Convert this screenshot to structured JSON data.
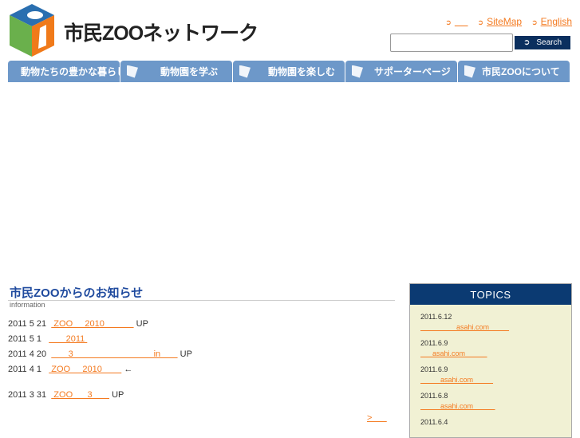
{
  "header": {
    "site_title": "市民ZOOネットワーク",
    "links": [
      "     ",
      "SiteMap",
      "English"
    ],
    "search_placeholder": "",
    "search_label": "Search"
  },
  "nav": [
    "動物たちの豊かな暮らし",
    "動物園を学ぶ",
    "動物園を楽しむ",
    "サポーターページ",
    "市民ZOOについて"
  ],
  "info": {
    "title": "市民ZOOからのお知らせ",
    "subtitle": "information",
    "items": [
      {
        "date": "2011 5 21",
        "link": " ZOO     2010            ",
        "suffix": "UP"
      },
      {
        "date": "2011 5 1 ",
        "link": "       2011 ",
        "suffix": ""
      },
      {
        "date": "2011 4 20",
        "link": "       3                                 in       ",
        "suffix": "UP"
      },
      {
        "date": "2011 4 1 ",
        "link": " ZOO     2010        ",
        "suffix": "←"
      },
      {
        "date": "2011 3 31",
        "link": " ZOO      3       ",
        "suffix": "UP"
      }
    ],
    "more": ">      "
  },
  "topics": {
    "title": "TOPICS",
    "items": [
      {
        "date": "2011.6.12",
        "link": "                  asahi.com          "
      },
      {
        "date": "2011.6.9",
        "link": "      asahi.com           "
      },
      {
        "date": "2011.6.9",
        "link": "          asahi.com          "
      },
      {
        "date": "2011.6.8",
        "link": "          asahi.com           "
      },
      {
        "date": "2011.6.4",
        "link": ""
      }
    ]
  }
}
